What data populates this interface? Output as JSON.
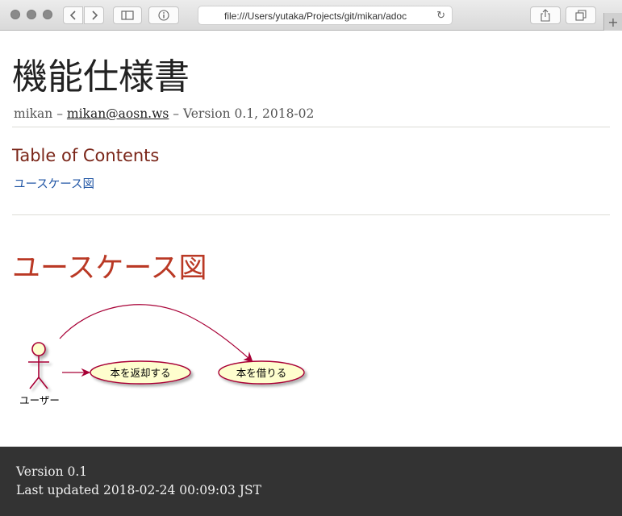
{
  "browser": {
    "url": "file:///Users/yutaka/Projects/git/mikan/adoc",
    "new_tab_symbol": "+"
  },
  "document": {
    "title": "機能仕様書",
    "author": "mikan",
    "email": "mikan@aosn.ws",
    "revision": "Version 0.1, 2018-02",
    "separator": "–"
  },
  "toc": {
    "title": "Table of Contents",
    "items": [
      "ユースケース図"
    ]
  },
  "section": {
    "title": "ユースケース図"
  },
  "diagram": {
    "actor": "ユーザー",
    "usecases": [
      "本を返却する",
      "本を借りる"
    ]
  },
  "footer": {
    "version": "Version 0.1",
    "last_updated": "Last updated 2018-02-24 00:09:03 JST"
  }
}
